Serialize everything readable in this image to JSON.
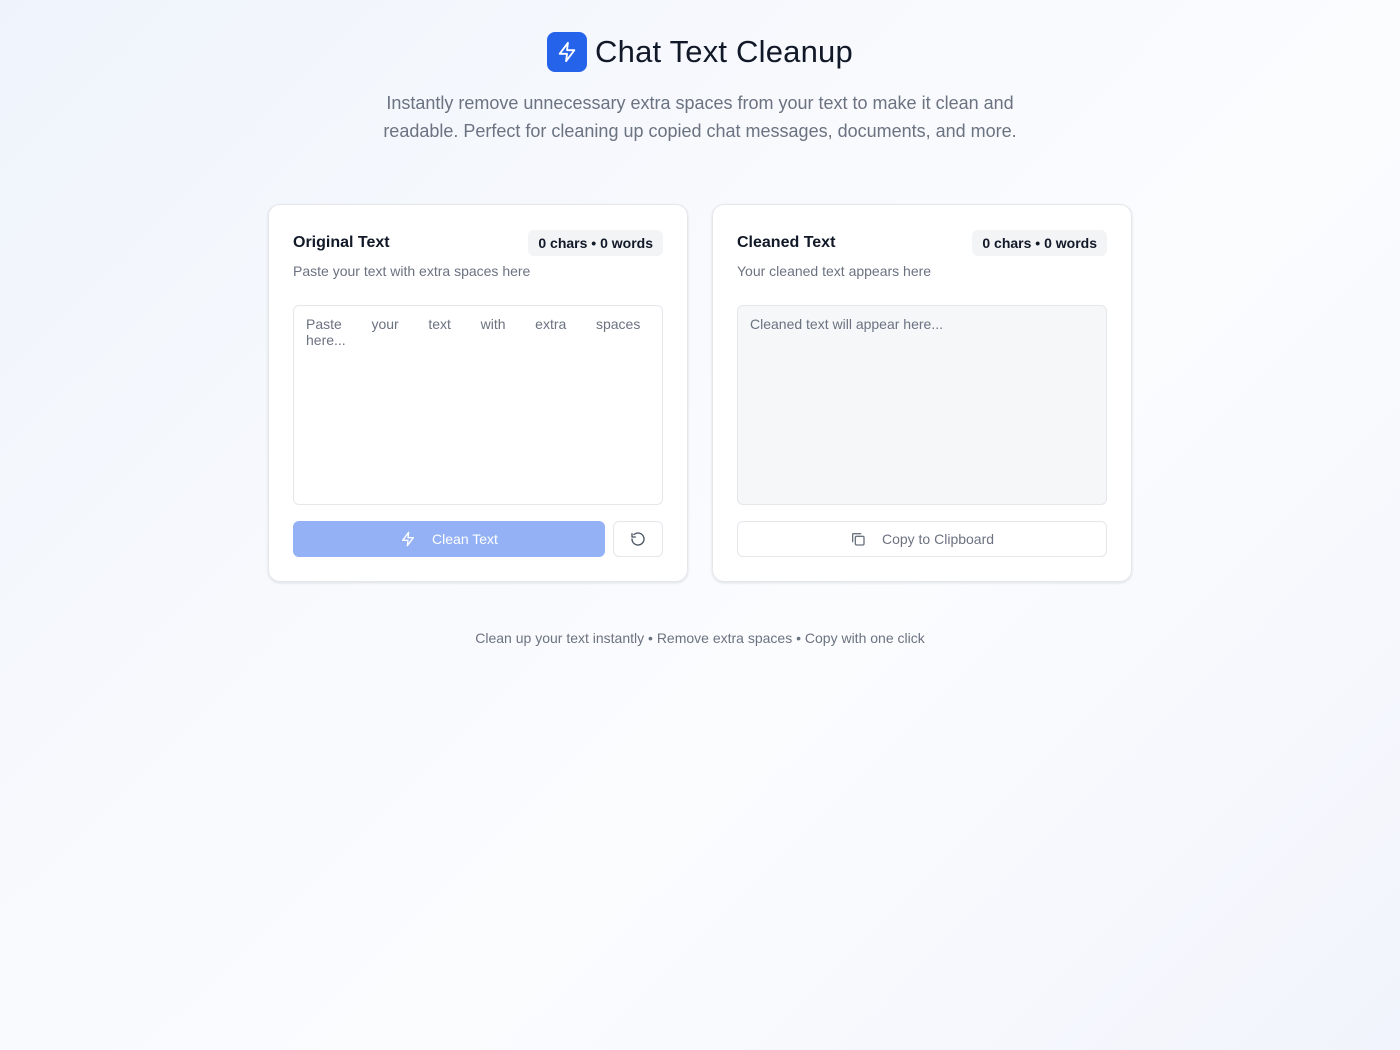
{
  "header": {
    "title": "Chat Text Cleanup",
    "logo_icon": "zap-icon",
    "subtitle": "Instantly remove unnecessary extra spaces from your text to make it clean and readable. Perfect for cleaning up copied chat messages, documents, and more."
  },
  "input_card": {
    "title": "Original Text",
    "stats": "0 chars • 0 words",
    "description": "Paste your text with extra spaces here",
    "placeholder": "Paste   your   text   with   extra   spaces   here...",
    "value": "",
    "clean_button": {
      "label": "Clean Text",
      "icon": "zap-icon",
      "enabled": false
    },
    "reset_button": {
      "icon": "reset-icon"
    }
  },
  "output_card": {
    "title": "Cleaned Text",
    "stats": "0 chars • 0 words",
    "description": "Your cleaned text appears here",
    "placeholder": "Cleaned text will appear here...",
    "copy_button": {
      "label": "Copy to Clipboard",
      "icon": "copy-icon",
      "enabled": false
    }
  },
  "footer": {
    "text": "Clean up your text instantly • Remove extra spaces • Copy with one click"
  },
  "colors": {
    "accent": "#2563eb",
    "accent_disabled": "#93b1f4",
    "muted_text": "#6b7280",
    "border": "#e5e7eb"
  }
}
